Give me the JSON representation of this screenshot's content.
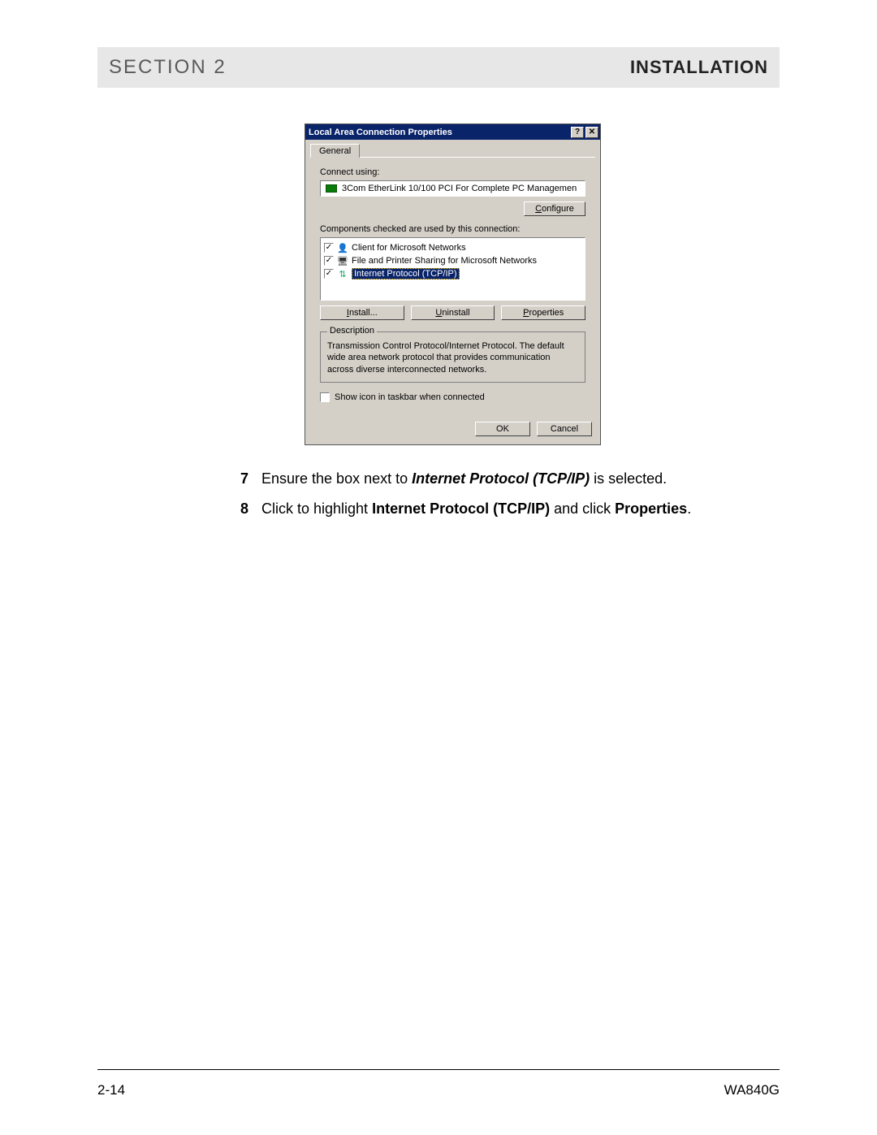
{
  "header": {
    "left": "SECTION 2",
    "right": "INSTALLATION"
  },
  "dialog": {
    "title": "Local Area Connection Properties",
    "help_btn": "?",
    "close_btn": "✕",
    "tab": "General",
    "connect_using_label": "Connect using:",
    "adapter": "3Com EtherLink 10/100 PCI For Complete PC Managemen",
    "configure_btn_pre": "C",
    "configure_btn_rest": "onfigure",
    "components_label": "Components checked are used by this connection:",
    "components": [
      {
        "checked": "✓",
        "icon": "client",
        "label": "Client for Microsoft Networks",
        "selected": false
      },
      {
        "checked": "✓",
        "icon": "share",
        "label": "File and Printer Sharing for Microsoft Networks",
        "selected": false
      },
      {
        "checked": "✓",
        "icon": "proto",
        "label": "Internet Protocol (TCP/IP)",
        "selected": true
      }
    ],
    "install_btn_pre": "I",
    "install_btn_rest": "nstall...",
    "uninstall_btn_pre": "U",
    "uninstall_btn_rest": "ninstall",
    "properties_btn_pre": "P",
    "properties_btn_rest": "roperties",
    "description_legend": "Description",
    "description_text": "Transmission Control Protocol/Internet Protocol. The default wide area network protocol that provides communication across diverse interconnected networks.",
    "show_icon_pre": "Sho",
    "show_icon_ul": "w",
    "show_icon_rest": " icon in taskbar when connected",
    "ok_btn": "OK",
    "cancel_btn": "Cancel"
  },
  "instructions": {
    "step7_num": "7",
    "step7_a": "Ensure the box next to ",
    "step7_b": "Internet Protocol (TCP/IP)",
    "step7_c": " is selected.",
    "step8_num": "8",
    "step8_a": "Click to highlight ",
    "step8_b": "Internet Protocol (TCP/IP)",
    "step8_c": " and click ",
    "step8_d": "Properties",
    "step8_e": "."
  },
  "footer": {
    "page": "2-14",
    "model": "WA840G"
  }
}
